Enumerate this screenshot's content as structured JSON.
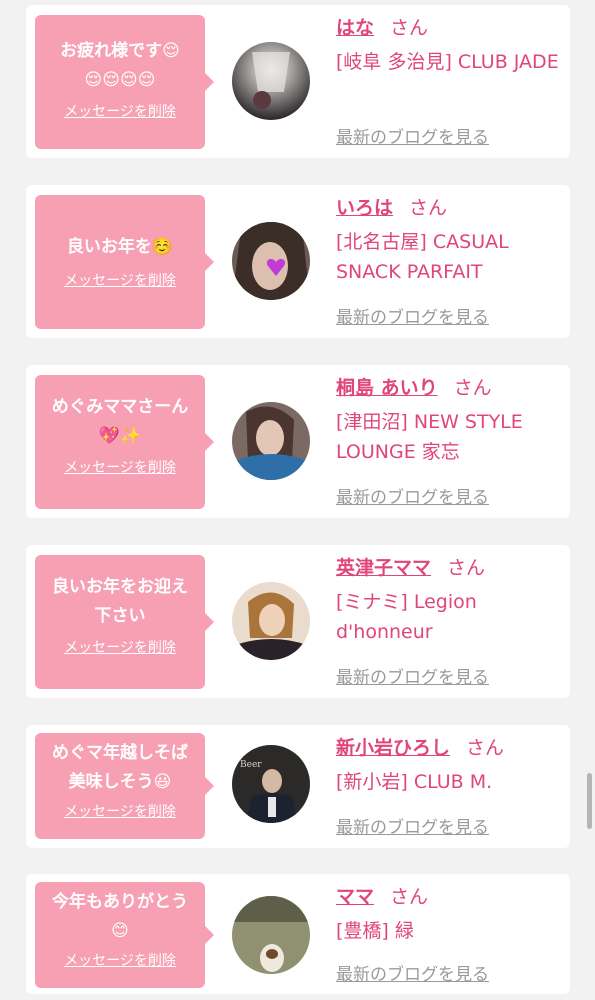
{
  "entries": [
    {
      "message": "お疲れ様です😌\n😌😌😌😌",
      "delete_label": "メッセージを削除",
      "name": "はな",
      "honorific": "さん",
      "shop": "[岐阜 多治見] CLUB JADE",
      "blog_label": "最新のブログを見る"
    },
    {
      "message": "良いお年を☺️",
      "delete_label": "メッセージを削除",
      "name": "いろは",
      "honorific": "さん",
      "shop": "[北名古屋] CASUAL SNACK PARFAIT",
      "blog_label": "最新のブログを見る"
    },
    {
      "message": "めぐみママさーん\n💖✨",
      "delete_label": "メッセージを削除",
      "name": "桐島 あいり",
      "honorific": "さん",
      "shop": "[津田沼] NEW STYLE LOUNGE 家忘",
      "blog_label": "最新のブログを見る"
    },
    {
      "message": "良いお年をお迎え\n下さい",
      "delete_label": "メッセージを削除",
      "name": "英津子ママ",
      "honorific": "さん",
      "shop": "[ミナミ] Legion d'honneur",
      "blog_label": "最新のブログを見る"
    },
    {
      "message": "めぐマ年越しそば\n美味しそう😃",
      "delete_label": "メッセージを削除",
      "name": "新小岩ひろし",
      "honorific": "さん",
      "shop": "[新小岩] CLUB M.",
      "blog_label": "最新のブログを見る"
    },
    {
      "message": "今年もありがとう\n😊",
      "delete_label": "メッセージを削除",
      "name": "ママ",
      "honorific": "さん",
      "shop": "[豊橋] 緑",
      "blog_label": "最新のブログを見る"
    }
  ],
  "colors": {
    "bubble": "#f7a0b4",
    "accent": "#e0457b",
    "muted": "#9a9a9a",
    "background": "#f2f2f2"
  }
}
